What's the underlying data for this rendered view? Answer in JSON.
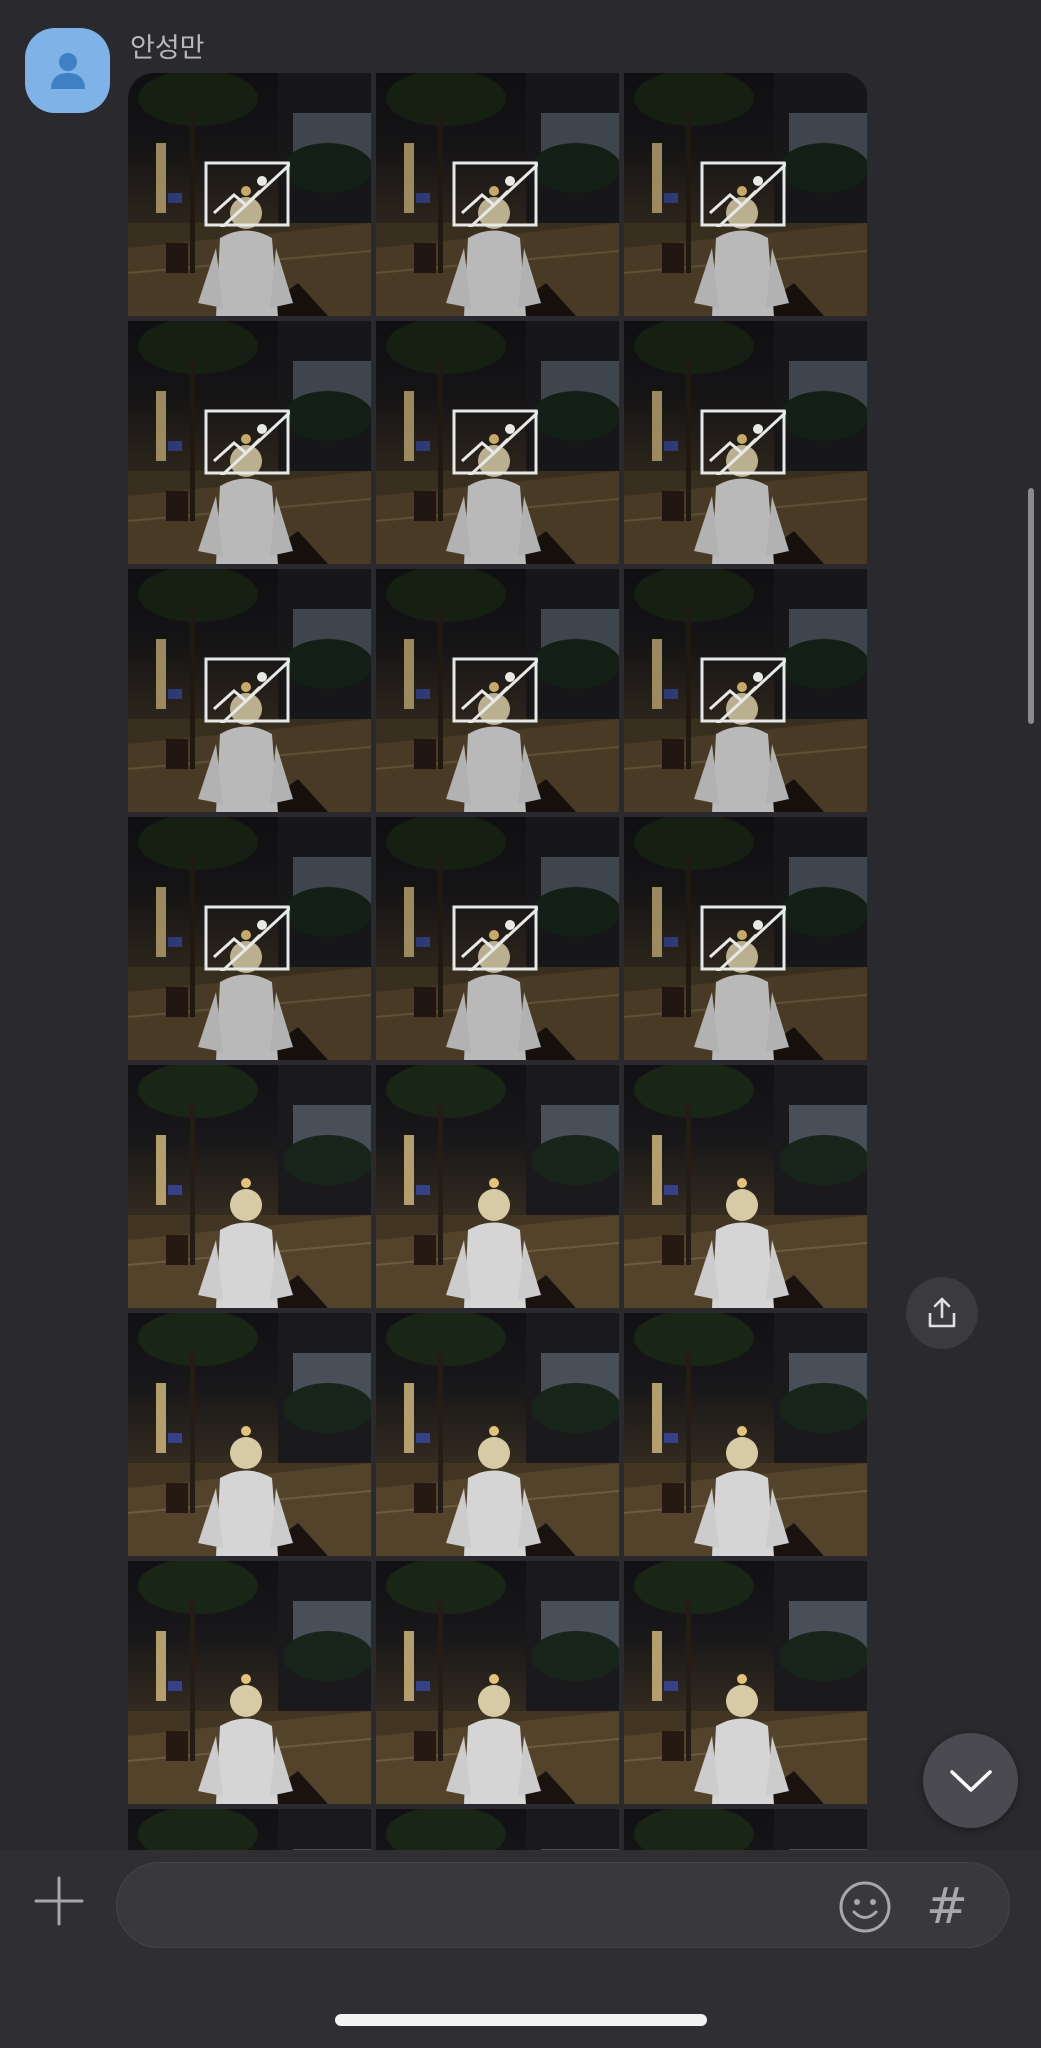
{
  "sender": {
    "name": "안성만",
    "avatar_icon": "person-icon",
    "avatar_color": "#7fb2e6"
  },
  "photo_grid": {
    "columns": 3,
    "photos": [
      {
        "status": "failed"
      },
      {
        "status": "failed"
      },
      {
        "status": "failed"
      },
      {
        "status": "failed"
      },
      {
        "status": "failed"
      },
      {
        "status": "failed"
      },
      {
        "status": "failed"
      },
      {
        "status": "failed"
      },
      {
        "status": "failed"
      },
      {
        "status": "failed"
      },
      {
        "status": "failed"
      },
      {
        "status": "failed"
      },
      {
        "status": "loaded"
      },
      {
        "status": "loaded"
      },
      {
        "status": "loaded"
      },
      {
        "status": "loaded"
      },
      {
        "status": "loaded"
      },
      {
        "status": "loaded"
      },
      {
        "status": "loaded"
      },
      {
        "status": "loaded"
      },
      {
        "status": "loaded"
      },
      {
        "status": "loaded"
      },
      {
        "status": "loaded"
      },
      {
        "status": "loaded"
      }
    ],
    "failed_overlay_icon": "image-broken-icon"
  },
  "actions": {
    "share_icon": "share-icon",
    "scroll_down_icon": "chevron-down-icon"
  },
  "composer": {
    "plus_icon": "plus-icon",
    "input_placeholder": "",
    "emoji_icon": "emoji-icon",
    "hashtag_label": "#"
  },
  "colors": {
    "background": "#2a2a2e",
    "composer_background": "#2f2f33"
  }
}
